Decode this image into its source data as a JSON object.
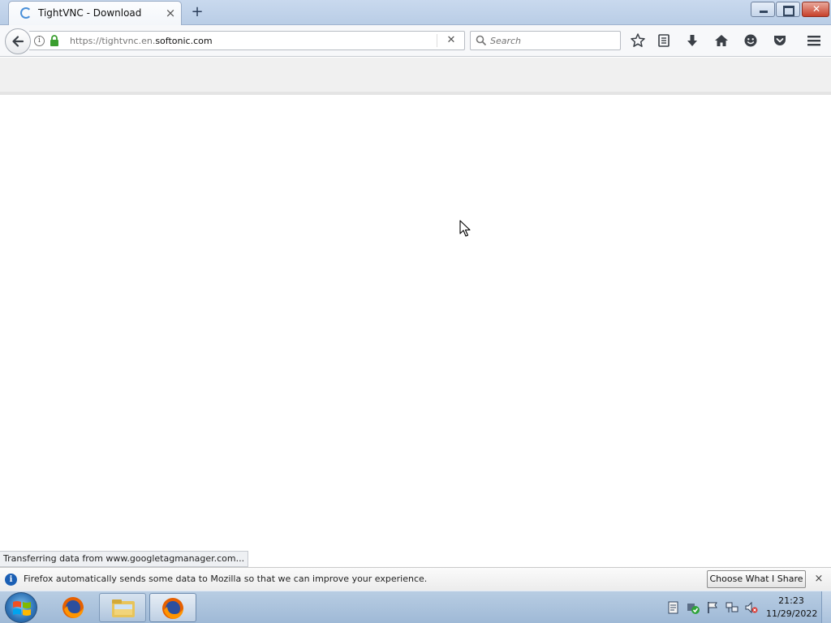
{
  "tab": {
    "title": "TightVNC - Download",
    "close_glyph": "×",
    "new_tab_glyph": "+"
  },
  "window_controls": [
    "minimize",
    "maximize",
    "close"
  ],
  "urlbar": {
    "url_prefix": "https://tightvnc.en.",
    "url_domain": "softonic.com",
    "stop_glyph": "✕"
  },
  "searchbar": {
    "placeholder": "Search"
  },
  "toolbar_icons": [
    "star-icon",
    "reading-list-icon",
    "download-icon",
    "home-icon",
    "hello-icon",
    "pocket-icon",
    "hamburger-menu-icon"
  ],
  "status": {
    "text": "Transferring data from www.googletagmanager.com..."
  },
  "notification": {
    "message": "Firefox automatically sends some data to Mozilla so that we can improve your experience.",
    "button_label": "Choose What I Share",
    "close_glyph": "×",
    "info_glyph": "i"
  },
  "taskbar": {
    "items": [
      "firefox-icon",
      "file-explorer-icon",
      "firefox-icon"
    ],
    "tray_icons": [
      "notes-icon",
      "security-check-icon",
      "action-center-flag-icon",
      "network-icon",
      "volume-muted-icon"
    ],
    "clock_time": "21:23",
    "clock_date": "11/29/2022"
  },
  "colors": {
    "accent": "#4a90d9",
    "notification_info": "#1b5fb4",
    "lock_green": "#3a9e2f"
  }
}
